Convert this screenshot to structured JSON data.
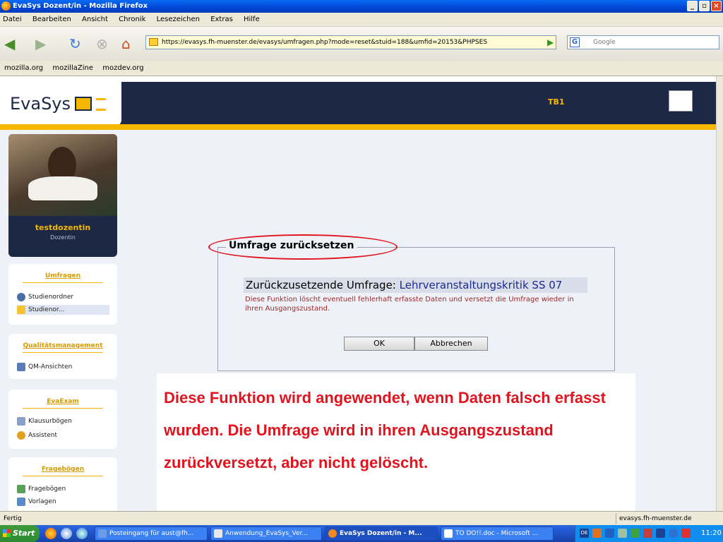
{
  "window": {
    "title": "EvaSys Dozent/in - Mozilla Firefox"
  },
  "menu": [
    "Datei",
    "Bearbeiten",
    "Ansicht",
    "Chronik",
    "Lesezeichen",
    "Extras",
    "Hilfe"
  ],
  "address": {
    "url": "https://evasys.fh-muenster.de/evasys/umfragen.php?mode=reset&stuid=188&umfid=20153&PHPSES"
  },
  "search": {
    "engine": "G",
    "placeholder": "Google"
  },
  "bookmarks": [
    "mozilla.org",
    "mozillaZine",
    "mozdev.org"
  ],
  "header": {
    "logo": "EvaSys",
    "center_label": "TB1"
  },
  "user": {
    "name": "testdozentin",
    "role": "Dozentin"
  },
  "sidebar": {
    "umfragen": {
      "title": "Umfragen",
      "items": [
        "Studienordner",
        "Studienor..."
      ]
    },
    "qm": {
      "title": "Qualitätsmanagement",
      "items": [
        "QM-Ansichten"
      ]
    },
    "evaexam": {
      "title": "EvaExam",
      "items": [
        "Klausurbögen",
        "Assistent"
      ]
    },
    "frageboegen": {
      "title": "Fragebögen",
      "items": [
        "Fragebögen",
        "Vorlagen"
      ]
    }
  },
  "dialog": {
    "legend": "Umfrage zurücksetzen",
    "label": "Zurückzusetzende Umfrage:",
    "survey_name": "Lehrveranstaltungskritik SS 07",
    "description": "Diese Funktion löscht eventuell fehlerhaft erfasste Daten und versetzt die Umfrage wieder in ihren Ausgangszustand.",
    "ok": "OK",
    "cancel": "Abbrechen"
  },
  "annotation": {
    "text": "Diese Funktion wird angewendet, wenn Daten falsch erfasst wurden. Die Umfrage wird in ihren Ausgangszustand zurückversetzt, aber nicht gelöscht."
  },
  "status": {
    "left": "Fertig",
    "right": "evasys.fh-muenster.de"
  },
  "taskbar": {
    "start": "Start",
    "tasks": [
      "Posteingang für aust@fh...",
      "Anwendung_EvaSys_Ver...",
      "EvaSys Dozent/in - M...",
      "TO DO!!.doc - Microsoft ..."
    ],
    "tray_lang": "DE",
    "clock": "11:20"
  },
  "colors": {
    "accent": "#f4b800",
    "navy": "#1c2845",
    "annotation": "#e0141e"
  }
}
